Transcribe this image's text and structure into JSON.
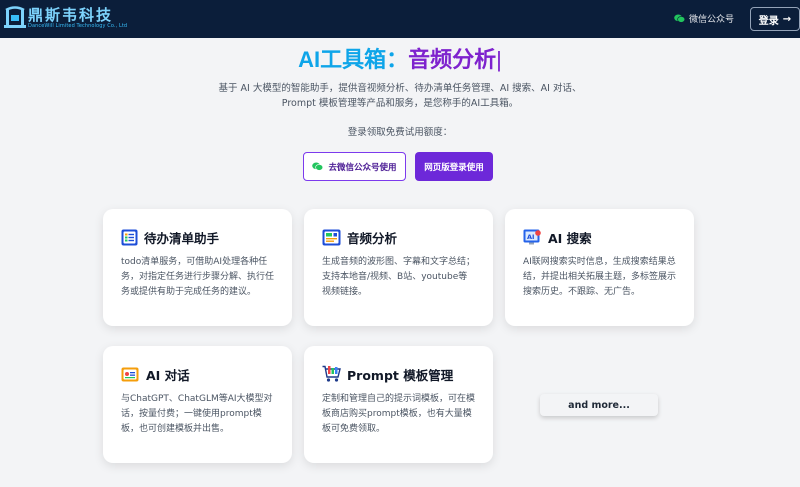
{
  "header": {
    "logo_cn": "鼎斯韦科技",
    "logo_en": "DanceWill Limited Technology Co., Ltd",
    "wechat_label": "微信公众号",
    "login_label": "登录",
    "login_arrow": "→"
  },
  "hero": {
    "title_prefix": "AI工具箱：",
    "title_highlight": "音频分析",
    "cursor": "|",
    "description": "基于 AI 大模型的智能助手，提供音视频分析、待办清单任务管理、AI 搜索、AI 对话、Prompt 模板管理等产品和服务，是您称手的AI工具箱。",
    "note": "登录领取免费试用额度：",
    "wechat_button": "去微信公众号使用",
    "web_button": "网页版登录使用"
  },
  "cards": [
    {
      "title": "待办清单助手",
      "icon": "checklist-icon",
      "desc": "todo清单服务，可借助AI处理各种任务，对指定任务进行步骤分解、执行任务或提供有助于完成任务的建议。"
    },
    {
      "title": "音频分析",
      "icon": "audio-analysis-icon",
      "desc": "生成音频的波形图、字幕和文字总结；支持本地音/视频、B站、youtube等视频链接。"
    },
    {
      "title": "AI 搜索",
      "icon": "ai-search-icon",
      "desc": "AI联网搜索实时信息，生成搜索结果总结，并提出相关拓展主题，多标签展示搜索历史。不跟踪、无广告。"
    },
    {
      "title": "AI 对话",
      "icon": "ai-chat-icon",
      "desc": "与ChatGPT、ChatGLM等AI大模型对话，按量付费；一键使用prompt模板，也可创建模板并出售。"
    },
    {
      "title": "Prompt 模板管理",
      "icon": "prompt-cart-icon",
      "desc": "定制和管理自己的提示词模板，可在模板商店购买prompt模板，也有大量模板可免费领取。"
    }
  ],
  "more_label": "and more...",
  "colors": {
    "header_bg": "#0b1e3a",
    "accent_blue": "#0ea5e9",
    "accent_purple": "#6d28d9",
    "wechat_green": "#22c55e"
  }
}
